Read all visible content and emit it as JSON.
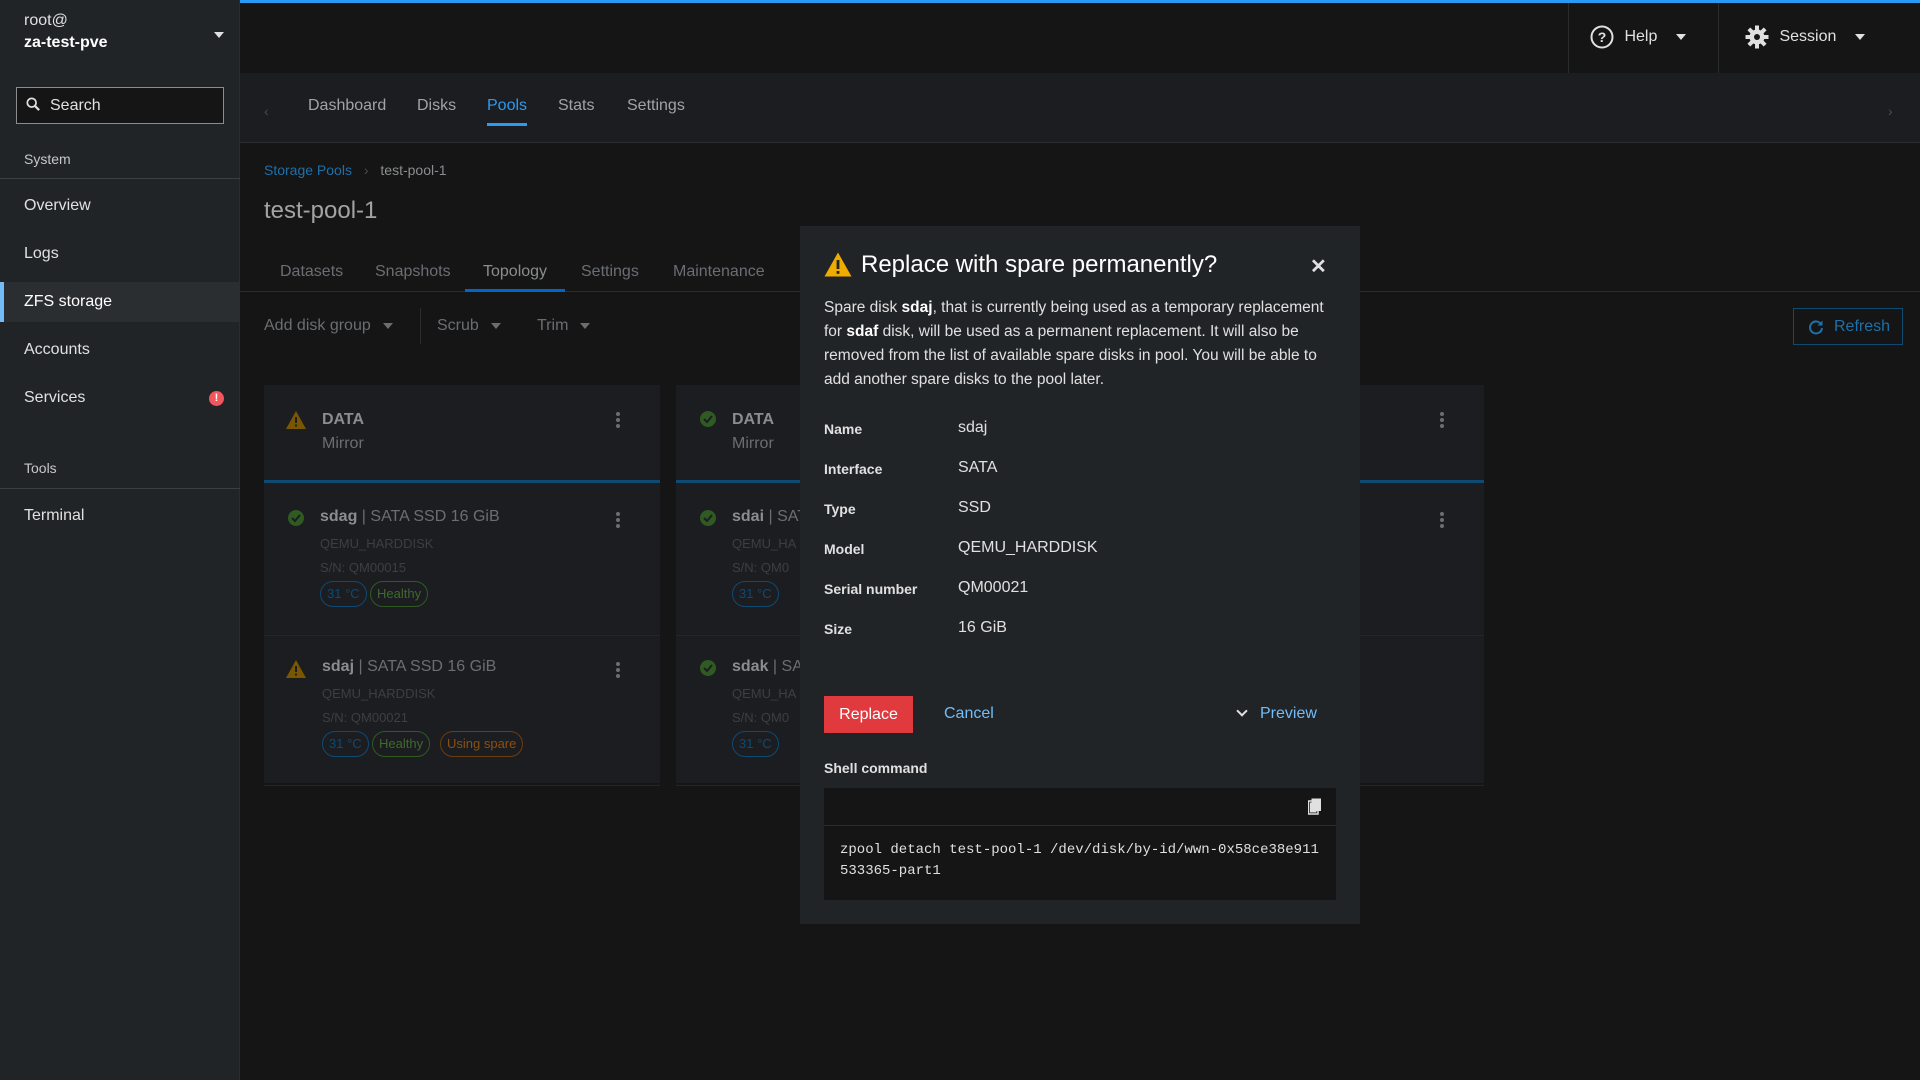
{
  "host": {
    "user": "root@",
    "name": "za-test-pve"
  },
  "search": {
    "placeholder": "Search"
  },
  "sidebar": {
    "section_system": "System",
    "items": [
      {
        "label": "Overview"
      },
      {
        "label": "Logs"
      },
      {
        "label": "ZFS storage"
      },
      {
        "label": "Accounts"
      },
      {
        "label": "Services"
      }
    ],
    "services_badge": "!",
    "section_tools": "Tools",
    "terminal": "Terminal"
  },
  "masthead": {
    "help": "Help",
    "session": "Session"
  },
  "nav_tabs": [
    "Dashboard",
    "Disks",
    "Pools",
    "Stats",
    "Settings"
  ],
  "breadcrumb": {
    "root": "Storage Pools",
    "current": "test-pool-1"
  },
  "page_title": "test-pool-1",
  "subtabs": [
    "Datasets",
    "Snapshots",
    "Topology",
    "Settings",
    "Maintenance"
  ],
  "toolbar": {
    "add_disk_group": "Add disk group",
    "scrub": "Scrub",
    "trim": "Trim",
    "refresh": "Refresh"
  },
  "cards": [
    {
      "title": "DATA",
      "subtitle": "Mirror",
      "disks": [
        {
          "name": "sdag",
          "desc": " | SATA SSD 16 GiB",
          "model": "QEMU_HARDDISK",
          "serial": "S/N: QM00015",
          "temp": "31 °C",
          "health": "Healthy"
        },
        {
          "name": "sdaj",
          "desc": " | SATA SSD 16 GiB",
          "model": "QEMU_HARDDISK",
          "serial": "S/N: QM00021",
          "temp": "31 °C",
          "health": "Healthy",
          "extra": "Using spare"
        }
      ]
    },
    {
      "title": "DATA",
      "subtitle": "Mirror",
      "disks": [
        {
          "name": "sdai",
          "desc": " | SAT",
          "model": "QEMU_HA",
          "serial": "S/N: QM0",
          "temp": "31 °C"
        },
        {
          "name": "sdak",
          "desc": " | SA",
          "model": "QEMU_HA",
          "serial": "S/N: QM0",
          "temp": "31 °C"
        }
      ]
    }
  ],
  "modal": {
    "title": "Replace with spare permanently?",
    "body_1": "Spare disk ",
    "body_disk1": "sdaj",
    "body_2": ", that is currently being used as a temporary replacement for ",
    "body_disk2": "sdaf",
    "body_3": " disk, will be used as a permanent replacement. It will also be removed from the list of available spare disks in pool. You will be able to add another spare disks to the pool later.",
    "details": [
      {
        "label": "Name",
        "value": "sdaj"
      },
      {
        "label": "Interface",
        "value": "SATA"
      },
      {
        "label": "Type",
        "value": "SSD"
      },
      {
        "label": "Model",
        "value": "QEMU_HARDDISK"
      },
      {
        "label": "Serial number",
        "value": "QM00021"
      },
      {
        "label": "Size",
        "value": "16 GiB"
      }
    ],
    "replace": "Replace",
    "cancel": "Cancel",
    "preview": "Preview",
    "shell_label": "Shell command",
    "command": "zpool detach test-pool-1 /dev/disk/by-id/wwn-0x58ce38e911533365-part1"
  },
  "colors": {
    "accent": "#2b9af3",
    "danger": "#e0393e",
    "link": "#73bcf7",
    "warning": "#f0ab00",
    "success": "#3e8635"
  }
}
